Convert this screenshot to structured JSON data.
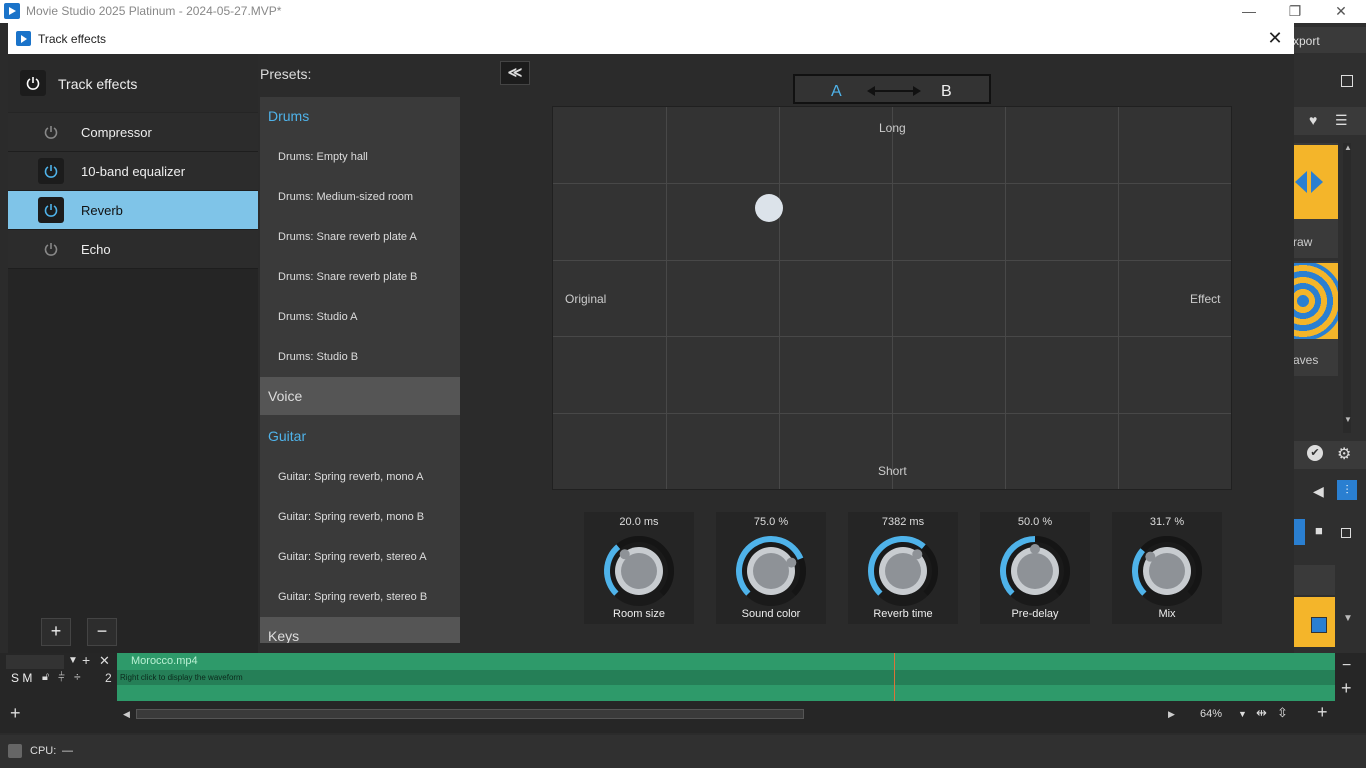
{
  "app": {
    "title": "Movie Studio 2025 Platinum - 2024-05-27.MVP*",
    "min_glyph": "—",
    "max_glyph": "❐",
    "close_glyph": "✕"
  },
  "background": {
    "export_label": "xport",
    "draw_label": "raw",
    "waves_label": "aves"
  },
  "dialog": {
    "title": "Track effects",
    "close_glyph": "✕"
  },
  "left_panel": {
    "header": "Track effects",
    "effects": [
      {
        "label": "Compressor",
        "active": false
      },
      {
        "label": "10-band equalizer",
        "active": true
      },
      {
        "label": "Reverb",
        "active": true,
        "selected": true
      },
      {
        "label": "Echo",
        "active": false
      }
    ],
    "add_glyph": "+",
    "remove_glyph": "−"
  },
  "presets": {
    "title": "Presets:",
    "categories": [
      {
        "name": "Drums",
        "items": [
          "Drums: Empty hall",
          "Drums: Medium-sized room",
          "Drums: Snare reverb plate A",
          "Drums: Snare reverb plate B",
          "Drums: Studio A",
          "Drums: Studio B"
        ]
      },
      {
        "name": "Voice",
        "items": []
      },
      {
        "name": "Guitar",
        "items": [
          "Guitar: Spring reverb, mono A",
          "Guitar: Spring reverb, mono B",
          "Guitar: Spring reverb, stereo A",
          "Guitar: Spring reverb, stereo B"
        ]
      },
      {
        "name": "Keys",
        "items": []
      }
    ]
  },
  "collapse_glyph": "≪",
  "ab": {
    "a": "A",
    "b": "B"
  },
  "pad": {
    "top_label": "Long",
    "bottom_label": "Short",
    "left_label": "Original",
    "right_label": "Effect",
    "dot_x_fraction": 0.318,
    "dot_y_fraction": 0.265
  },
  "knobs": [
    {
      "name": "Room size",
      "value": "20.0 ms",
      "fraction": 0.35
    },
    {
      "name": "Sound color",
      "value": "75.0 %",
      "fraction": 0.75
    },
    {
      "name": "Reverb time",
      "value": "7382 ms",
      "fraction": 0.65
    },
    {
      "name": "Pre-delay",
      "value": "50.0 %",
      "fraction": 0.5
    },
    {
      "name": "Mix",
      "value": "31.7 %",
      "fraction": 0.317
    }
  ],
  "colors": {
    "accent": "#4fb3ea",
    "selected": "#7fc4e8",
    "clip": "#2e9a6a",
    "playhead": "#d9733a"
  },
  "timeline": {
    "clip_name": "Morocco.mp4",
    "clip_hint": "Right click to display the waveform",
    "track_number": "2",
    "track_controls": "S M",
    "zoom": "64%"
  },
  "status": {
    "cpu_label": "CPU:",
    "cpu_value": "—"
  }
}
